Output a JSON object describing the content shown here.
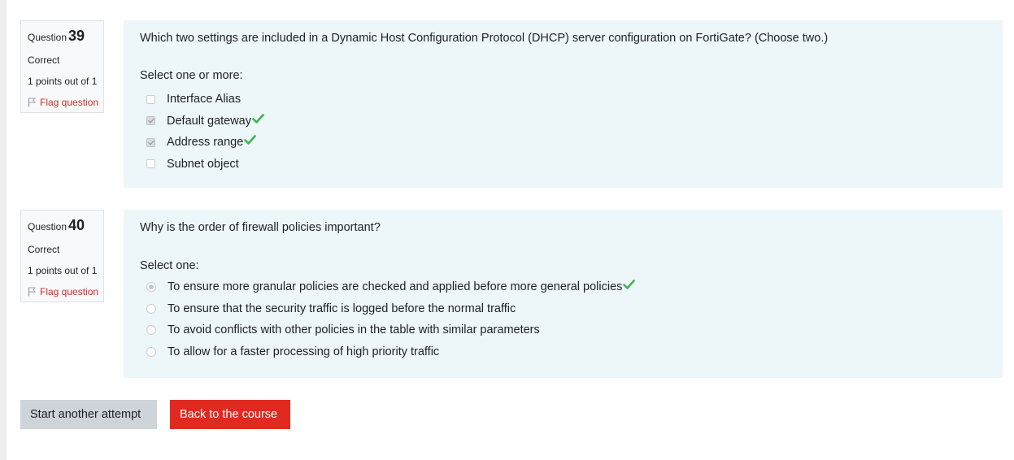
{
  "colors": {
    "info_bg": "#f8f9fa",
    "content_bg": "#edf6f8",
    "flag_text": "#c9302c",
    "correct_tick": "#3fb24f",
    "primary_button": "#e12a1f",
    "secondary_button": "#ced4da"
  },
  "questions": [
    {
      "label": "Question",
      "number": "39",
      "status": "Correct",
      "grade": "1 points out of 1",
      "flag_label": "Flag question",
      "flag_icon": "flag-icon",
      "text": "Which two settings are included in a Dynamic Host Configuration Protocol (DHCP) server configuration on FortiGate? (Choose two.)",
      "prompt": "Select one or more:",
      "answers": [
        {
          "label": "Interface Alias",
          "checked": false,
          "correct": false
        },
        {
          "label": "Default gateway",
          "checked": true,
          "correct": true
        },
        {
          "label": "Address range",
          "checked": true,
          "correct": true
        },
        {
          "label": "Subnet object",
          "checked": false,
          "correct": false
        }
      ]
    },
    {
      "label": "Question",
      "number": "40",
      "status": "Correct",
      "grade": "1 points out of 1",
      "flag_label": "Flag question",
      "flag_icon": "flag-icon",
      "text": "Why is the order of firewall policies important?",
      "prompt": "Select one:",
      "answers": [
        {
          "label": "To ensure more granular policies are checked and applied before more general policies",
          "checked": true,
          "correct": true
        },
        {
          "label": "To ensure that the security traffic is logged before the normal traffic",
          "checked": false,
          "correct": false
        },
        {
          "label": "To avoid conflicts with other policies in the table with similar parameters",
          "checked": false,
          "correct": false
        },
        {
          "label": "To allow for a faster processing of high priority traffic",
          "checked": false,
          "correct": false
        }
      ]
    }
  ],
  "buttons": {
    "start_another_attempt": "Start another attempt",
    "back_to_course": "Back to the course"
  }
}
